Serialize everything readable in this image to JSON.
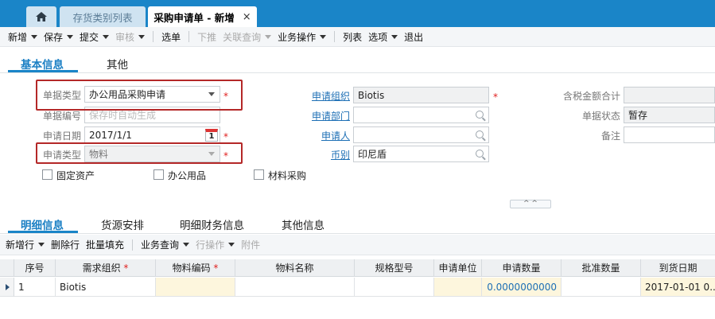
{
  "tabs": {
    "home_icon": "home-icon",
    "inventory_tab": "存货类别列表",
    "request_tab": "采购申请单 - 新增",
    "close": "×"
  },
  "toolbar": {
    "new": "新增",
    "save": "保存",
    "submit": "提交",
    "review": "审核",
    "select_bill": "选单",
    "push_down": "下推",
    "related_query": "关联查询",
    "business_ops": "业务操作",
    "list": "列表",
    "options": "选项",
    "exit": "退出"
  },
  "section_tabs": {
    "basic": "基本信息",
    "other": "其他"
  },
  "form": {
    "bill_type_label": "单据类型",
    "bill_type_value": "办公用品采购申请",
    "bill_no_label": "单据编号",
    "bill_no_placeholder": "保存时自动生成",
    "request_date_label": "申请日期",
    "request_date_value": "2017/1/1",
    "calendar_day": "1",
    "request_kind_label": "申请类型",
    "request_kind_value": "物料",
    "req_org_label": "申请组织",
    "req_org_value": "Biotis",
    "req_dept_label": "申请部门",
    "requester_label": "申请人",
    "currency_label": "币别",
    "currency_value": "印尼盾",
    "total_label": "含税金额合计",
    "status_label": "单据状态",
    "status_value": "暂存",
    "remark_label": "备注",
    "required_mark": "*"
  },
  "checkboxes": {
    "fixed_assets": "固定资产",
    "office_supplies": "办公用品",
    "material_purchase": "材料采购"
  },
  "collapse_toggle": "^ ^",
  "detail_tabs": {
    "detail": "明细信息",
    "source": "货源安排",
    "finance": "明细财务信息",
    "other": "其他信息"
  },
  "detail_toolbar": {
    "add_row": "新增行",
    "delete_row": "删除行",
    "batch_fill": "批量填充",
    "business_query": "业务查询",
    "row_ops": "行操作",
    "attachment": "附件"
  },
  "grid": {
    "columns": [
      "序号",
      "需求组织",
      "物料编码",
      "物料名称",
      "规格型号",
      "申请单位",
      "申请数量",
      "批准数量",
      "到货日期"
    ],
    "required_star": "*",
    "rows": [
      {
        "seq": "1",
        "org": "Biotis",
        "code": "",
        "name": "",
        "spec": "",
        "unit": "",
        "qty": "0.0000000000",
        "approved": "",
        "arrival": "2017-01-01 0..."
      }
    ]
  },
  "colors": {
    "tab_blue": "#1a85c8",
    "link_blue": "#1d6fb5",
    "required_red": "#e0201f",
    "highlight_box": "#b42828"
  }
}
